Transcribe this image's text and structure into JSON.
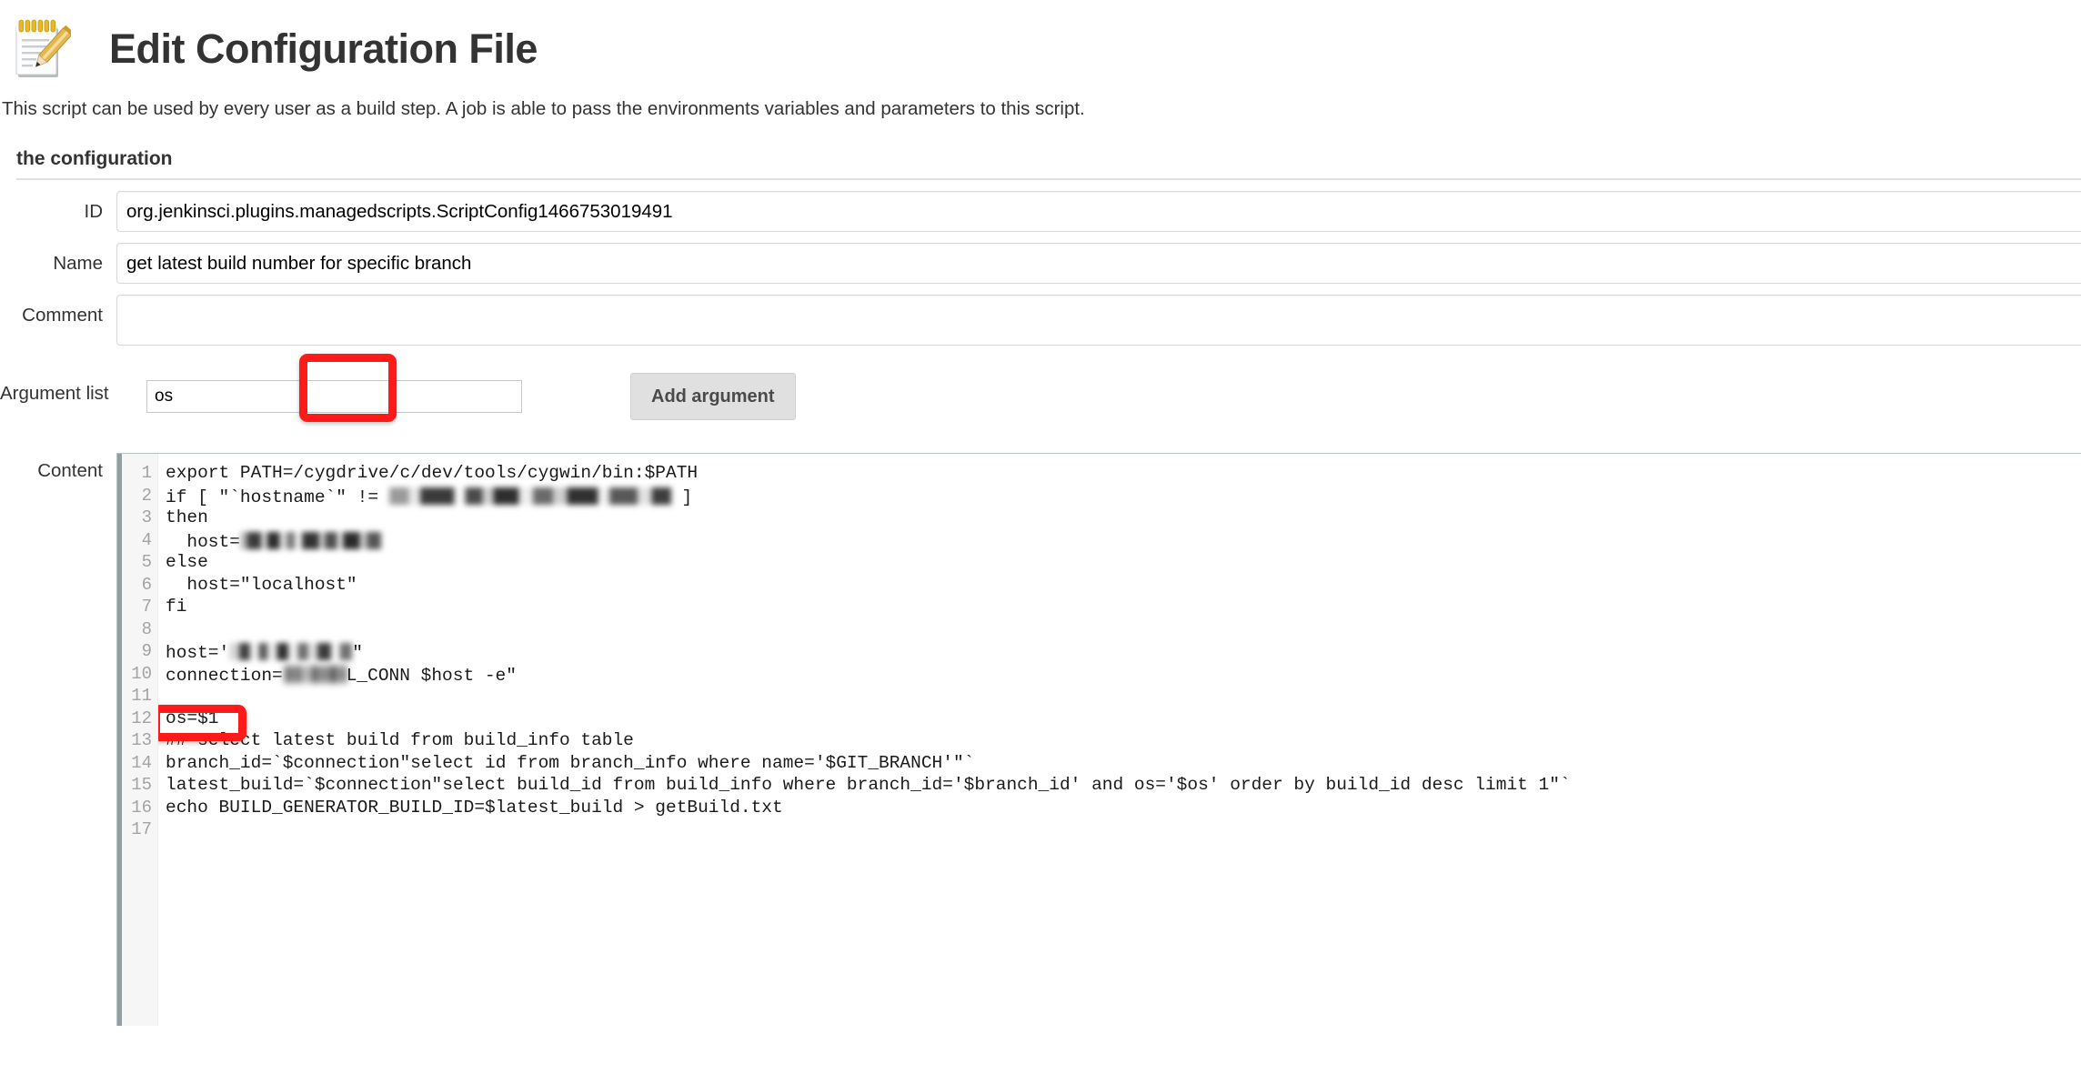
{
  "header": {
    "icon": "notepad-pencil-icon",
    "title": "Edit Configuration File"
  },
  "description": "This script can be used by every user as a build step. A job is able to pass the environments variables and parameters to this script.",
  "section": {
    "title": "the configuration"
  },
  "fields": {
    "id": {
      "label": "ID",
      "value": "org.jenkinsci.plugins.managedscripts.ScriptConfig1466753019491",
      "placeholder": ""
    },
    "name": {
      "label": "Name",
      "value": "get latest build number for specific branch",
      "placeholder": ""
    },
    "comment": {
      "label": "Comment",
      "value": "",
      "placeholder": ""
    },
    "argument_list": {
      "label": "Argument list",
      "value": "os",
      "placeholder": "",
      "add_button_label": "Add argument"
    },
    "content": {
      "label": "Content"
    }
  },
  "annotations": {
    "color": "#ff1a1a",
    "boxes": [
      "argument-list-input",
      "code-line-12"
    ]
  },
  "editor": {
    "line_numbers": [
      "1",
      "2",
      "3",
      "4",
      "5",
      "6",
      "7",
      "8",
      "9",
      "10",
      "11",
      "12",
      "13",
      "14",
      "15",
      "16",
      "17"
    ],
    "lines": [
      {
        "n": "1",
        "text": "export PATH=/cygdrive/c/dev/tools/cygwin/bin:$PATH"
      },
      {
        "n": "2",
        "pre": "if [ \"`hostname`\" != ",
        "redacted": true,
        "redact_w": 310,
        "redact_variant": "",
        "post": " ]"
      },
      {
        "n": "3",
        "text": "then"
      },
      {
        "n": "4",
        "pre": "  host=",
        "redacted": true,
        "redact_w": 155,
        "redact_variant": "r2",
        "post": ""
      },
      {
        "n": "5",
        "text": "else"
      },
      {
        "n": "6",
        "text": "  host=\"localhost\""
      },
      {
        "n": "7",
        "text": "fi"
      },
      {
        "n": "8",
        "text": ""
      },
      {
        "n": "9",
        "pre": "host='",
        "redacted": true,
        "redact_w": 135,
        "redact_variant": "r3",
        "post": "\""
      },
      {
        "n": "10",
        "pre": "connection=",
        "redacted": true,
        "redact_w": 70,
        "redact_variant": "r2 soft",
        "post": "L_CONN $host -e\""
      },
      {
        "n": "11",
        "text": ""
      },
      {
        "n": "12",
        "text": "os=$1"
      },
      {
        "n": "13",
        "text": "## select latest build from build_info table"
      },
      {
        "n": "14",
        "text": "branch_id=`$connection\"select id from branch_info where name='$GIT_BRANCH'\"`"
      },
      {
        "n": "15",
        "text": "latest_build=`$connection\"select build_id from build_info where branch_id='$branch_id' and os='$os' order by build_id desc limit 1\"`"
      },
      {
        "n": "16",
        "text": "echo BUILD_GENERATOR_BUILD_ID=$latest_build > getBuild.txt"
      },
      {
        "n": "17",
        "text": ""
      }
    ]
  }
}
